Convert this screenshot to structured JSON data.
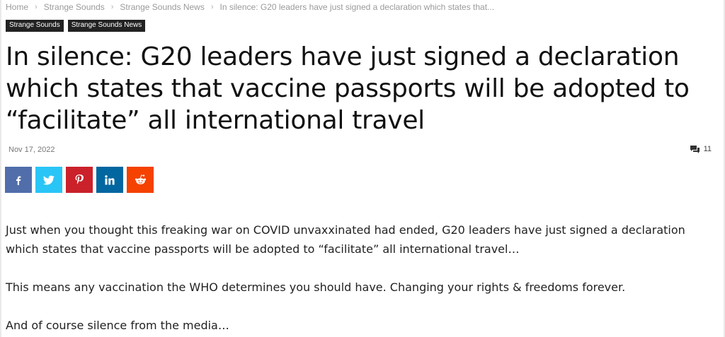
{
  "breadcrumb": {
    "items": [
      "Home",
      "Strange Sounds",
      "Strange Sounds News"
    ],
    "current": "In silence: G20 leaders have just signed a declaration which states that..."
  },
  "categories": [
    "Strange Sounds",
    "Strange Sounds News"
  ],
  "article": {
    "title": "In silence: G20 leaders have just signed a declaration which states that vaccine passports will be adopted to “facilitate” all international travel",
    "date": "Nov 17, 2022",
    "comment_count": "11",
    "paragraphs": [
      "Just when you thought this freaking war on COVID unvaxxinated had ended, G20 leaders have just signed a declaration which states that vaccine passports will be adopted to “facilitate” all international travel…",
      "This means any vaccination the WHO determines you should have. Changing your rights & freedoms forever.",
      "And of course silence from the media…"
    ]
  },
  "share_buttons": [
    {
      "icon": "facebook-icon",
      "color": "#516eab"
    },
    {
      "icon": "twitter-icon",
      "color": "#29c5f6"
    },
    {
      "icon": "pinterest-icon",
      "color": "#ca212a"
    },
    {
      "icon": "linkedin-icon",
      "color": "#0266a0"
    },
    {
      "icon": "reddit-icon",
      "color": "#f54200"
    }
  ],
  "colors": {
    "category_bg": "#222222",
    "text": "#111111",
    "muted": "#9a9a9a"
  }
}
